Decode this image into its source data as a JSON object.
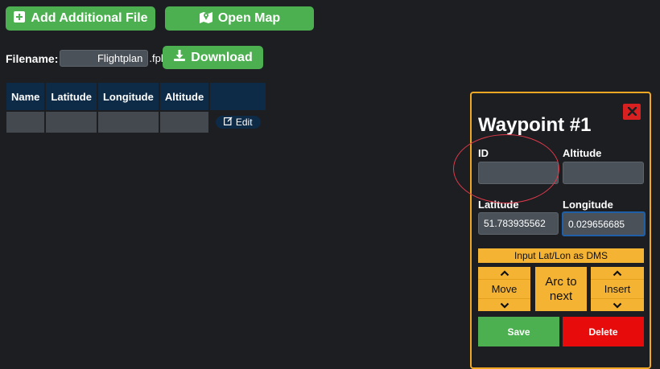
{
  "toolbar": {
    "add_file_label": "Add Additional File",
    "open_map_label": "Open Map",
    "download_label": "Download"
  },
  "filename": {
    "label": "Filename:",
    "value": "Flightplan",
    "extension": ".fpl"
  },
  "table": {
    "headers": [
      "Name",
      "Latitude",
      "Longitude",
      "Altitude"
    ],
    "edit_label": "Edit"
  },
  "panel": {
    "title": "Waypoint #1",
    "id_label": "ID",
    "id_value": "",
    "altitude_label": "Altitude",
    "altitude_value": "",
    "latitude_label": "Latitude",
    "latitude_value": "51.783935562",
    "longitude_label": "Longitude",
    "longitude_value": "0.029656685",
    "dms_label": "Input Lat/Lon as DMS",
    "move_label": "Move",
    "arc_label_line1": "Arc to",
    "arc_label_line2": "next",
    "insert_label": "Insert",
    "save_label": "Save",
    "delete_label": "Delete"
  },
  "colors": {
    "background": "#1c1e22",
    "green": "#4caf50",
    "orange": "#f5b334",
    "panel_border": "#f0a824",
    "navy": "#0d2a47",
    "red": "#e80b0b",
    "annotation": "#e03a4a"
  },
  "icons": {
    "add_file": "plus-square-icon",
    "open_map": "map-marker-icon",
    "download": "download-icon",
    "edit": "edit-icon",
    "close": "close-icon"
  }
}
